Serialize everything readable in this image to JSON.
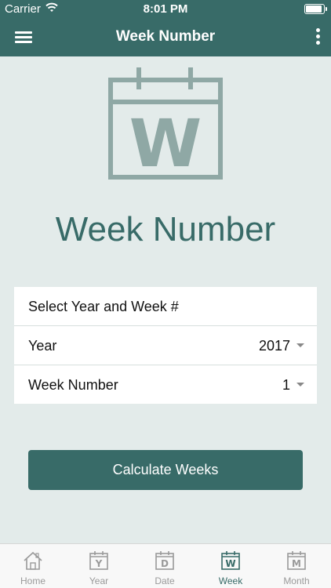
{
  "status": {
    "carrier": "Carrier",
    "time": "8:01 PM"
  },
  "nav": {
    "title": "Week Number"
  },
  "hero": {
    "letter": "W",
    "title": "Week Number"
  },
  "form": {
    "header": "Select Year and Week #",
    "year_label": "Year",
    "year_value": "2017",
    "week_label": "Week Number",
    "week_value": "1"
  },
  "calc_label": "Calculate Weeks",
  "tabs": [
    {
      "label": "Home",
      "letter": ""
    },
    {
      "label": "Year",
      "letter": "Y"
    },
    {
      "label": "Date",
      "letter": "D"
    },
    {
      "label": "Week",
      "letter": "W"
    },
    {
      "label": "Month",
      "letter": "M"
    }
  ],
  "colors": {
    "primary": "#386b68",
    "hero_icon": "#8fa8a5",
    "background": "#e3ebea",
    "tab_inactive": "#9a9a9a"
  }
}
